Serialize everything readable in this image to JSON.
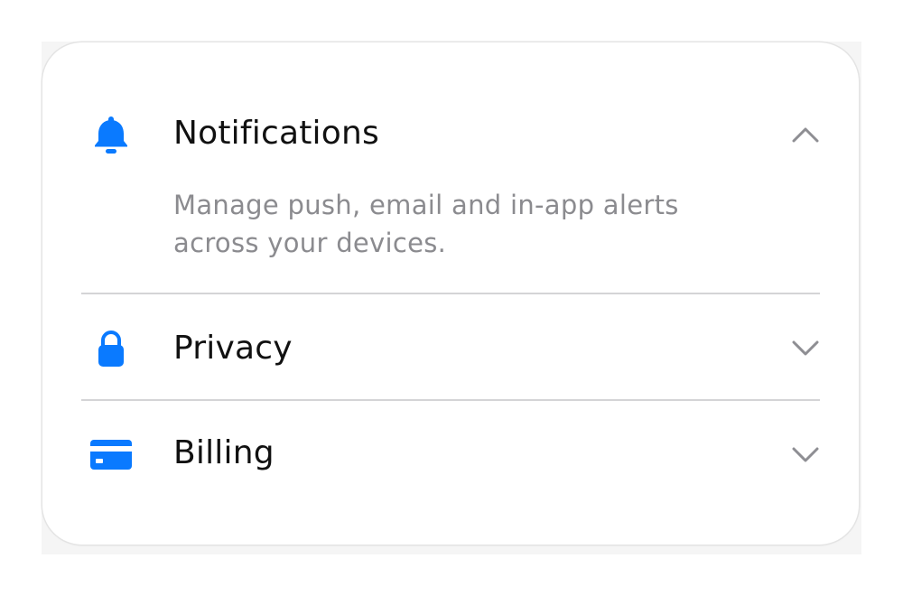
{
  "accent_color": "#0a7aff",
  "sections": [
    {
      "title": "Notifications",
      "icon": "bell-icon",
      "expanded": true,
      "chevron": "chevron-up-icon",
      "description": "Manage push, email and in-app alerts across your devices."
    },
    {
      "title": "Privacy",
      "icon": "lock-icon",
      "expanded": false,
      "chevron": "chevron-down-icon"
    },
    {
      "title": "Billing",
      "icon": "credit-card-icon",
      "expanded": false,
      "chevron": "chevron-down-icon"
    }
  ]
}
